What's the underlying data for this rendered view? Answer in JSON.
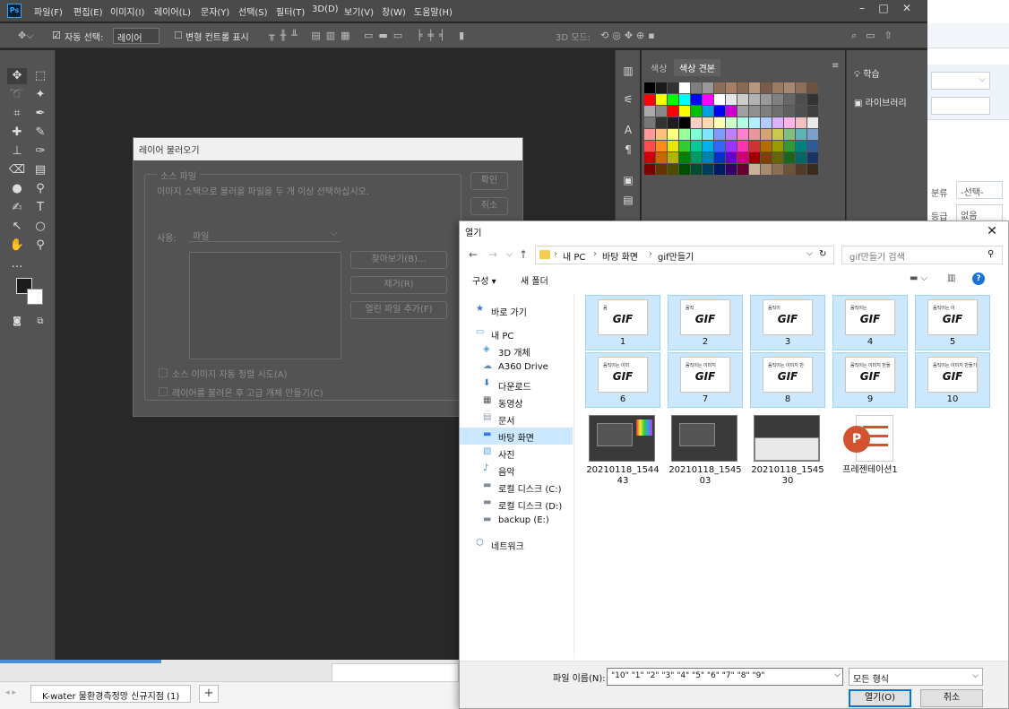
{
  "photoshop": {
    "menu": [
      "파일(F)",
      "편집(E)",
      "이미지(I)",
      "레이어(L)",
      "문자(Y)",
      "선택(S)",
      "필터(T)",
      "3D(D)",
      "보기(V)",
      "창(W)",
      "도움말(H)"
    ],
    "logo": "Ps",
    "options": {
      "auto_select": "자동 선택:",
      "auto_select_value": "레이어",
      "transform_controls": "변형 컨트롤 표시",
      "mode_3d": "3D 모드:"
    },
    "swatch_tabs": [
      "색상",
      "색상 견본"
    ],
    "right_panel": [
      "학습",
      "라이브러리"
    ]
  },
  "load_layers": {
    "title": "레이어 불러오기",
    "group_label": "소스 파일",
    "instruction": "이미지 스택으로 불러올 파일을 두 개 이상 선택하십시오.",
    "use_label": "사용:",
    "use_value": "파일",
    "ok": "확인",
    "cancel": "취소",
    "browse": "찾아보기(B)...",
    "remove": "제거(R)",
    "add_open": "열린 파일 추가(F)",
    "checkbox1": "소스 이미지 자동 정렬 시도(A)",
    "checkbox2": "레이어를 불러온 후 고급 개체 만들기(C)"
  },
  "open_dialog": {
    "title": "열기",
    "path": [
      "내 PC",
      "바탕 화면",
      "gif만들기"
    ],
    "search_placeholder": "gif만들기 검색",
    "organize": "구성 ▾",
    "new_folder": "새 폴더",
    "nav": [
      {
        "label": "바로 가기",
        "icon": "star-icon"
      },
      {
        "label": "내 PC",
        "icon": "pc-icon"
      },
      {
        "label": "3D 개체",
        "icon": "cube-icon"
      },
      {
        "label": "A360 Drive",
        "icon": "cloud-icon"
      },
      {
        "label": "다운로드",
        "icon": "download-icon"
      },
      {
        "label": "동영상",
        "icon": "video-icon"
      },
      {
        "label": "문서",
        "icon": "document-icon"
      },
      {
        "label": "바탕 화면",
        "icon": "desktop-icon"
      },
      {
        "label": "사진",
        "icon": "picture-icon"
      },
      {
        "label": "음악",
        "icon": "music-icon"
      },
      {
        "label": "로컬 디스크 (C:)",
        "icon": "drive-icon"
      },
      {
        "label": "로컬 디스크 (D:)",
        "icon": "drive-icon"
      },
      {
        "label": "backup (E:)",
        "icon": "drive-icon"
      },
      {
        "label": "네트워크",
        "icon": "network-icon"
      }
    ],
    "gif_files": [
      {
        "name": "1",
        "caption": "움"
      },
      {
        "name": "2",
        "caption": "움직"
      },
      {
        "name": "3",
        "caption": "움직이"
      },
      {
        "name": "4",
        "caption": "움직이는"
      },
      {
        "name": "5",
        "caption": "움직이는 이"
      },
      {
        "name": "6",
        "caption": "움직이는 이미"
      },
      {
        "name": "7",
        "caption": "움직이는 이미지"
      },
      {
        "name": "8",
        "caption": "움직이는 이미지 만"
      },
      {
        "name": "9",
        "caption": "움직이는 이미지 만들"
      },
      {
        "name": "10",
        "caption": "움직이는 이미지 만들기"
      }
    ],
    "gif_text": "GIF",
    "other_files": [
      {
        "line1": "20210118_1544",
        "line2": "43"
      },
      {
        "line1": "20210118_1545",
        "line2": "03"
      },
      {
        "line1": "20210118_1545",
        "line2": "30"
      },
      {
        "line1": "프레젠테이션1",
        "line2": ""
      }
    ],
    "filename_label": "파일 이름(N):",
    "filename_value": "\"10\" \"1\" \"2\" \"3\" \"4\" \"5\" \"6\" \"7\" \"8\" \"9\"",
    "filetype": "모든 형식",
    "open_button": "열기(O)",
    "cancel_button": "취소"
  },
  "background_app": {
    "cell_a": "분류",
    "cell_b": "-선택-",
    "cell_c": "등급",
    "cell_d": "없음"
  },
  "sheet": {
    "tab": "K-water 물환경측정망 신규지점 (1)",
    "add": "+"
  },
  "colors": {
    "swatches": [
      "#000000",
      "#1a1a1a",
      "#333333",
      "#ffffff",
      "#7f7f7f",
      "#999999",
      "#8c6d5a",
      "#a57e64",
      "#8a6a52",
      "#b8977f",
      "#7a5c48",
      "#9d7b63",
      "#a88870",
      "#8f6e58",
      "#6d5242",
      "#ff0000",
      "#ffff00",
      "#00ff00",
      "#00ffff",
      "#0000ff",
      "#ff00ff",
      "#ffffff",
      "#e6e6e6",
      "#cccccc",
      "#b3b3b3",
      "#999999",
      "#808080",
      "#666666",
      "#4d4d4d",
      "#333333",
      "#aaaaaa",
      "#888888",
      "#ff0000",
      "#ffff00",
      "#00c000",
      "#00a0e0",
      "#0000ff",
      "#cc00cc",
      "#a0a0a0",
      "#909090",
      "#7f7f7f",
      "#6f6f6f",
      "#5f5f5f",
      "#4f4f4f",
      "#3f3f3f",
      "#777777",
      "#333333",
      "#1e1e1e",
      "#000000",
      "#ffcccc",
      "#ffd9b3",
      "#ffffb3",
      "#ccffcc",
      "#b3ffe6",
      "#b3f0ff",
      "#b3ccff",
      "#d9b3ff",
      "#ffb3e6",
      "#f2c2c2",
      "#eaeaea",
      "#ff9999",
      "#ffbf80",
      "#ffff80",
      "#99ff99",
      "#80ffd4",
      "#80e6ff",
      "#8099ff",
      "#bf80ff",
      "#ff80cc",
      "#e89898",
      "#d4a373",
      "#c9c94d",
      "#7fbf7f",
      "#5fb3b3",
      "#7f9fcf",
      "#ff4d4d",
      "#ff8c1a",
      "#e6e600",
      "#33cc33",
      "#00cc99",
      "#00b3e6",
      "#3366ff",
      "#9933ff",
      "#ff33aa",
      "#cc3333",
      "#b36b00",
      "#999900",
      "#339933",
      "#008080",
      "#2e5c99",
      "#cc0000",
      "#cc6600",
      "#b3b300",
      "#008000",
      "#009966",
      "#0080b3",
      "#0033cc",
      "#6600cc",
      "#cc0077",
      "#990000",
      "#804000",
      "#666600",
      "#1a661a",
      "#006666",
      "#1a3366",
      "#800000",
      "#663300",
      "#4d4d00",
      "#004d00",
      "#004d33",
      "#003d59",
      "#001a66",
      "#330066",
      "#660033",
      "#c9b299",
      "#a88a6e",
      "#8c6e52",
      "#6e533b",
      "#523c28",
      "#3d2b1a"
    ]
  }
}
